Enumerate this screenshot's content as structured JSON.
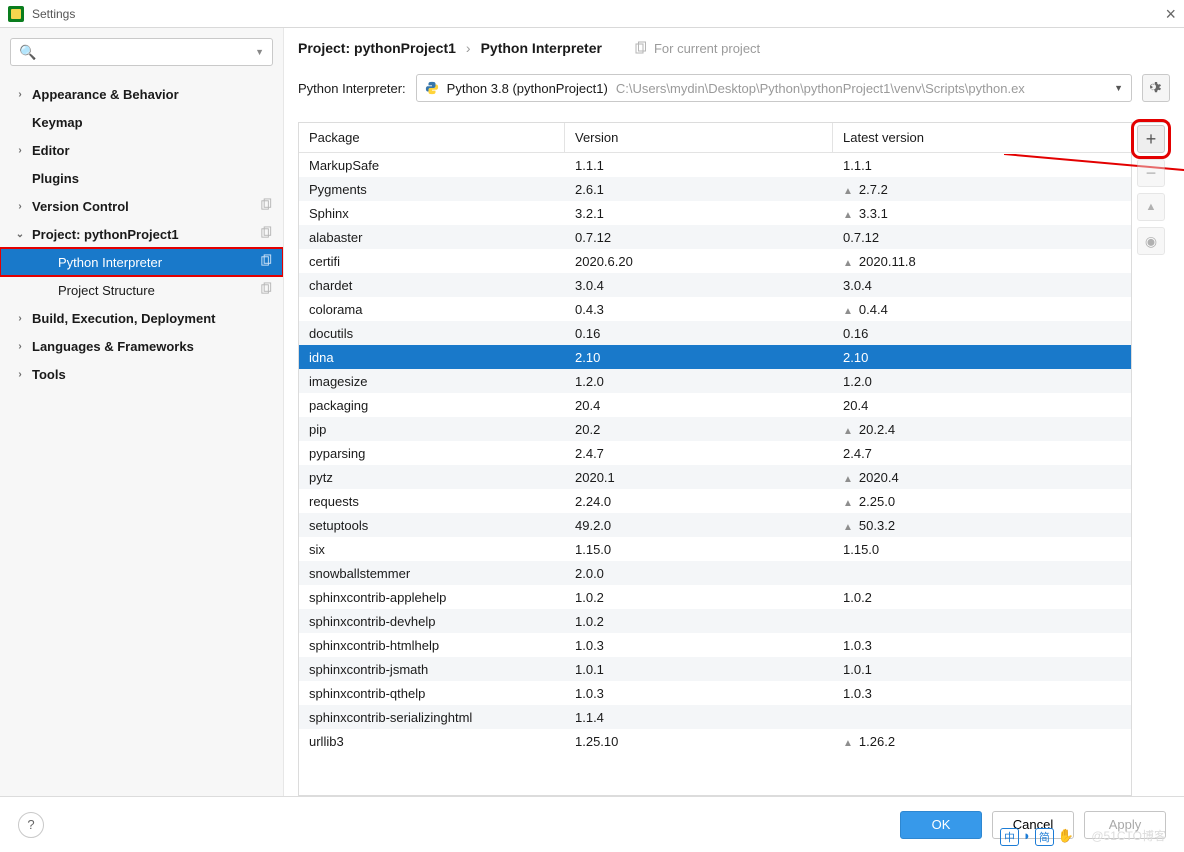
{
  "window": {
    "title": "Settings",
    "close": "×"
  },
  "search": {
    "placeholder": ""
  },
  "sidebar": {
    "items": [
      {
        "label": "Appearance & Behavior",
        "bold": true,
        "expandable": true,
        "expanded": false
      },
      {
        "label": "Keymap",
        "bold": true,
        "expandable": false
      },
      {
        "label": "Editor",
        "bold": true,
        "expandable": true,
        "expanded": false
      },
      {
        "label": "Plugins",
        "bold": true,
        "expandable": false
      },
      {
        "label": "Version Control",
        "bold": true,
        "expandable": true,
        "expanded": false,
        "copy": true
      },
      {
        "label": "Project: pythonProject1",
        "bold": true,
        "expandable": true,
        "expanded": true,
        "copy": true
      },
      {
        "label": "Python Interpreter",
        "depth": 1,
        "selected": true,
        "copy": true,
        "red": true
      },
      {
        "label": "Project Structure",
        "depth": 1,
        "copy": true
      },
      {
        "label": "Build, Execution, Deployment",
        "bold": true,
        "expandable": true,
        "expanded": false
      },
      {
        "label": "Languages & Frameworks",
        "bold": true,
        "expandable": true,
        "expanded": false
      },
      {
        "label": "Tools",
        "bold": true,
        "expandable": true,
        "expanded": false
      }
    ]
  },
  "breadcrumb": {
    "root": "Project: pythonProject1",
    "sep": "›",
    "leaf": "Python Interpreter",
    "hint": "For current project"
  },
  "interpreter": {
    "label": "Python Interpreter:",
    "name": "Python 3.8 (pythonProject1)",
    "path": "C:\\Users\\mydin\\Desktop\\Python\\pythonProject1\\venv\\Scripts\\python.ex"
  },
  "columns": {
    "pkg": "Package",
    "ver": "Version",
    "lat": "Latest version"
  },
  "packages": [
    {
      "name": "MarkupSafe",
      "version": "1.1.1",
      "latest": "1.1.1",
      "upgrade": false
    },
    {
      "name": "Pygments",
      "version": "2.6.1",
      "latest": "2.7.2",
      "upgrade": true
    },
    {
      "name": "Sphinx",
      "version": "3.2.1",
      "latest": "3.3.1",
      "upgrade": true
    },
    {
      "name": "alabaster",
      "version": "0.7.12",
      "latest": "0.7.12",
      "upgrade": false
    },
    {
      "name": "certifi",
      "version": "2020.6.20",
      "latest": "2020.11.8",
      "upgrade": true
    },
    {
      "name": "chardet",
      "version": "3.0.4",
      "latest": "3.0.4",
      "upgrade": false
    },
    {
      "name": "colorama",
      "version": "0.4.3",
      "latest": "0.4.4",
      "upgrade": true
    },
    {
      "name": "docutils",
      "version": "0.16",
      "latest": "0.16",
      "upgrade": false
    },
    {
      "name": "idna",
      "version": "2.10",
      "latest": "2.10",
      "upgrade": false,
      "selected": true
    },
    {
      "name": "imagesize",
      "version": "1.2.0",
      "latest": "1.2.0",
      "upgrade": false
    },
    {
      "name": "packaging",
      "version": "20.4",
      "latest": "20.4",
      "upgrade": false
    },
    {
      "name": "pip",
      "version": "20.2",
      "latest": "20.2.4",
      "upgrade": true
    },
    {
      "name": "pyparsing",
      "version": "2.4.7",
      "latest": "2.4.7",
      "upgrade": false
    },
    {
      "name": "pytz",
      "version": "2020.1",
      "latest": "2020.4",
      "upgrade": true
    },
    {
      "name": "requests",
      "version": "2.24.0",
      "latest": "2.25.0",
      "upgrade": true
    },
    {
      "name": "setuptools",
      "version": "49.2.0",
      "latest": "50.3.2",
      "upgrade": true
    },
    {
      "name": "six",
      "version": "1.15.0",
      "latest": "1.15.0",
      "upgrade": false
    },
    {
      "name": "snowballstemmer",
      "version": "2.0.0",
      "latest": "",
      "upgrade": false
    },
    {
      "name": "sphinxcontrib-applehelp",
      "version": "1.0.2",
      "latest": "1.0.2",
      "upgrade": false
    },
    {
      "name": "sphinxcontrib-devhelp",
      "version": "1.0.2",
      "latest": "",
      "upgrade": false
    },
    {
      "name": "sphinxcontrib-htmlhelp",
      "version": "1.0.3",
      "latest": "1.0.3",
      "upgrade": false
    },
    {
      "name": "sphinxcontrib-jsmath",
      "version": "1.0.1",
      "latest": "1.0.1",
      "upgrade": false
    },
    {
      "name": "sphinxcontrib-qthelp",
      "version": "1.0.3",
      "latest": "1.0.3",
      "upgrade": false
    },
    {
      "name": "sphinxcontrib-serializinghtml",
      "version": "1.1.4",
      "latest": "",
      "upgrade": false
    },
    {
      "name": "urllib3",
      "version": "1.25.10",
      "latest": "1.26.2",
      "upgrade": true
    }
  ],
  "sideButtons": {
    "add": "+",
    "remove": "−",
    "up": "▲",
    "eye": "◉"
  },
  "footer": {
    "help": "?",
    "ok": "OK",
    "cancel": "Cancel",
    "apply": "Apply"
  },
  "watermark": "@51CTO博客",
  "ime": [
    "中",
    "简"
  ]
}
